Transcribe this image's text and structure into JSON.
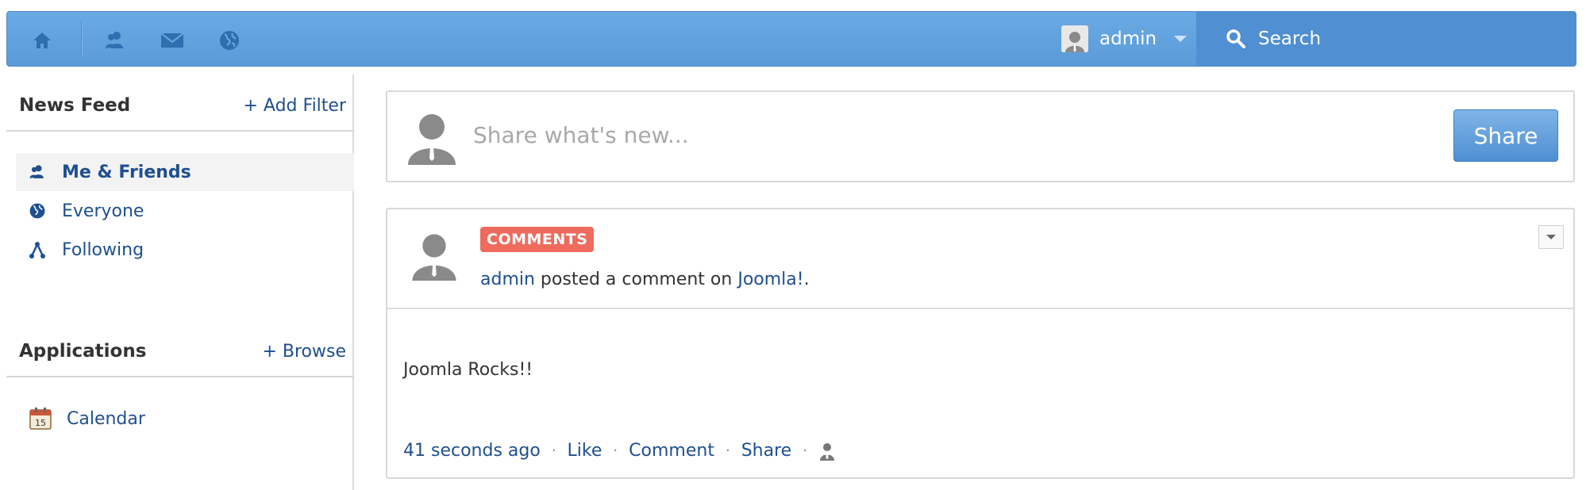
{
  "topbar": {
    "nav_icons": [
      "home-icon",
      "friends-icon",
      "mail-icon",
      "globe-icon"
    ],
    "user": {
      "name": "admin"
    },
    "search": {
      "label": "Search"
    }
  },
  "sidebar": {
    "news_feed": {
      "title": "News Feed",
      "action": "+ Add Filter",
      "items": [
        {
          "label": "Me & Friends",
          "icon": "friends-icon",
          "active": true
        },
        {
          "label": "Everyone",
          "icon": "globe-icon",
          "active": false
        },
        {
          "label": "Following",
          "icon": "following-icon",
          "active": false
        }
      ]
    },
    "applications": {
      "title": "Applications",
      "action": "+ Browse",
      "items": [
        {
          "label": "Calendar",
          "icon": "calendar-icon"
        }
      ]
    }
  },
  "composer": {
    "placeholder": "Share what's new...",
    "button": "Share"
  },
  "post": {
    "badge": "COMMENTS",
    "actor": "admin",
    "action_text": " posted a comment on ",
    "target": "Joomla!",
    "suffix": ".",
    "body": "Joomla Rocks!!",
    "time": "41 seconds ago",
    "actions": {
      "like": "Like",
      "comment": "Comment",
      "share": "Share"
    }
  },
  "colors": {
    "topbar": "#5a9bd8",
    "search_bg": "#4f8fd2",
    "link": "#1f4f8f",
    "badge": "#ee6b5d"
  }
}
